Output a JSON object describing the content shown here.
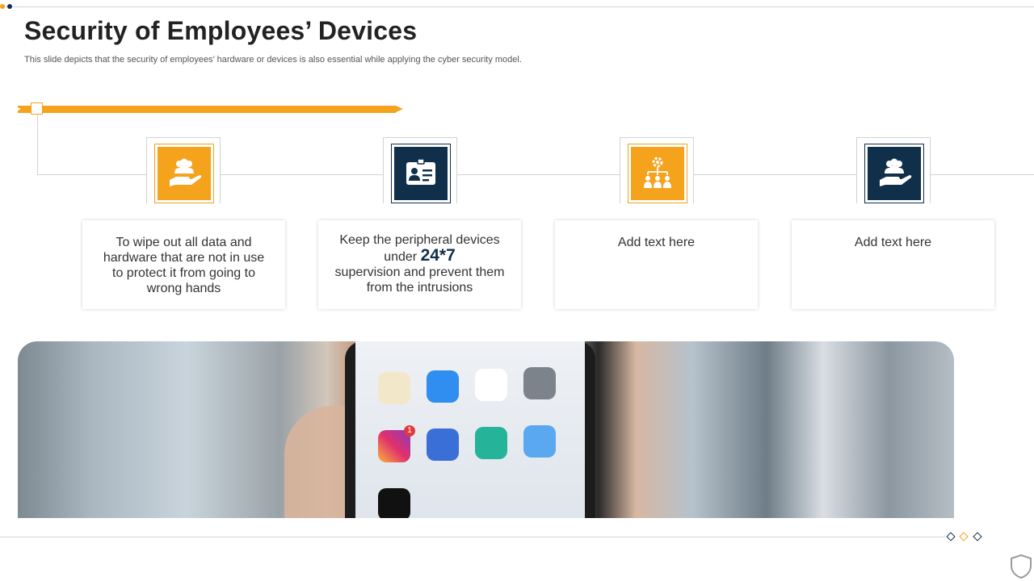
{
  "slide": {
    "title": "Security of Employees’ Devices",
    "subtitle": "This slide depicts that the security of employees’ hardware or devices is also essential while applying the cyber security model."
  },
  "colors": {
    "accent": "#f5a21d",
    "navy": "#0f2f4b",
    "line": "#d2d2d2"
  },
  "steps": [
    {
      "icon": "people-in-hand-icon",
      "color": "orange",
      "text": "To wipe out all data and hardware that are not in use to protect it from going to wrong hands"
    },
    {
      "icon": "id-card-icon",
      "color": "navy",
      "text_before": "Keep the peripheral devices under",
      "highlight": "24*7",
      "text_after": "supervision and prevent them from the intrusions"
    },
    {
      "icon": "team-hierarchy-gear-icon",
      "color": "orange",
      "text": "Add text here"
    },
    {
      "icon": "people-in-hand-icon",
      "color": "navy",
      "text": "Add text here"
    }
  ],
  "photo": {
    "subject": "hand holding smartphone showing app icons",
    "notification_badge": "1"
  }
}
